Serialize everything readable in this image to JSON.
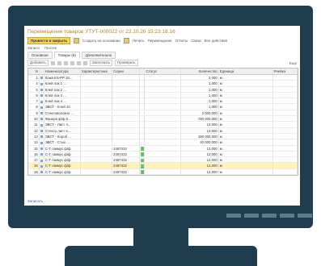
{
  "document": {
    "title": "Перемещение товаров УТУТ-000022 от 22.10.20 15:23:18.16",
    "toolbar": {
      "post_close": "Провести и закрыть",
      "items": [
        "Создать на основании",
        "Печать",
        "Перемещение",
        "Отчеты",
        "Связи",
        "Все действия"
      ]
    },
    "nav": [
      "Записи",
      "Прочее"
    ],
    "tabs": [
      "Основное",
      "Товары (8)",
      "Дополнительно"
    ],
    "subtoolbar": {
      "add": "Добавить",
      "fill": "Заполнить",
      "check": "Проверить",
      "more": "Еще"
    },
    "columns": [
      "N",
      "Номенклатура",
      "Характеристика",
      "Серии",
      "Статус",
      "Количество",
      "Единица",
      "Ячейка"
    ],
    "rows": [
      {
        "n": "1",
        "name": "Кожа KS-PP 18...",
        "qty": "2,000",
        "unit": "м",
        "serial": "",
        "checked": false,
        "selected": false
      },
      {
        "n": "4",
        "name": "Клей лак 1 ...",
        "qty": "1,000",
        "unit": "м",
        "serial": "",
        "checked": false,
        "selected": false
      },
      {
        "n": "5",
        "name": "Клей лак 2 ...",
        "qty": "1,000",
        "unit": "м",
        "serial": "",
        "checked": false,
        "selected": false
      },
      {
        "n": "6",
        "name": "Клей лак 3 ...",
        "qty": "1,000",
        "unit": "м",
        "serial": "",
        "checked": false,
        "selected": false
      },
      {
        "n": "7",
        "name": "Клей лак 4 ...",
        "qty": "1,000",
        "unit": "м",
        "serial": "",
        "checked": false,
        "selected": false
      },
      {
        "n": "8",
        "name": "ЭВСТ - Клей 10",
        "qty": "1,000",
        "unit": "м",
        "serial": "",
        "checked": false,
        "selected": false
      },
      {
        "n": "9",
        "name": "Стекловолокно ...",
        "qty": "2 000,000",
        "unit": "м",
        "serial": "",
        "checked": false,
        "selected": false
      },
      {
        "n": "10",
        "name": "Фанера ф/ф 6...",
        "qty": "780 000,000",
        "unit": "м",
        "serial": "",
        "checked": false,
        "selected": false
      },
      {
        "n": "11",
        "name": "ЭВСТ - Лист 4...",
        "qty": "12,000",
        "unit": "м",
        "serial": "",
        "checked": false,
        "selected": false
      },
      {
        "n": "12",
        "name": "Стекло лист 4...",
        "qty": "12,000",
        "unit": "м",
        "serial": "",
        "checked": false,
        "selected": false
      },
      {
        "n": "13",
        "name": "ЭВСТ - Короб ...",
        "qty": "180 000,000",
        "unit": "м",
        "serial": "",
        "checked": false,
        "selected": false
      },
      {
        "n": "14",
        "name": "ЭВСТ - Стык ...",
        "qty": "40 000,000",
        "unit": "м",
        "serial": "",
        "checked": false,
        "selected": false
      },
      {
        "n": "15",
        "name": "С-Т лакмус ф/ф",
        "qty": "12,000",
        "unit": "м",
        "serial": "2487432",
        "checked": true,
        "selected": false
      },
      {
        "n": "16",
        "name": "С-Т лакмус ф/ф",
        "qty": "12,000",
        "unit": "м",
        "serial": "2487432",
        "checked": true,
        "selected": false
      },
      {
        "n": "17",
        "name": "С-Т лакмус ф/ф",
        "qty": "12,000",
        "unit": "м",
        "serial": "2487432",
        "checked": true,
        "selected": false
      },
      {
        "n": "18",
        "name": "С-Т лакмус ф/ф",
        "qty": "12,000",
        "unit": "м",
        "serial": "2487432",
        "checked": true,
        "selected": true
      },
      {
        "n": "19",
        "name": "С-Т лакмус ф/ф",
        "qty": "12,000",
        "unit": "м",
        "serial": "2487432",
        "checked": true,
        "selected": false
      }
    ],
    "footer_link": "Записать"
  }
}
